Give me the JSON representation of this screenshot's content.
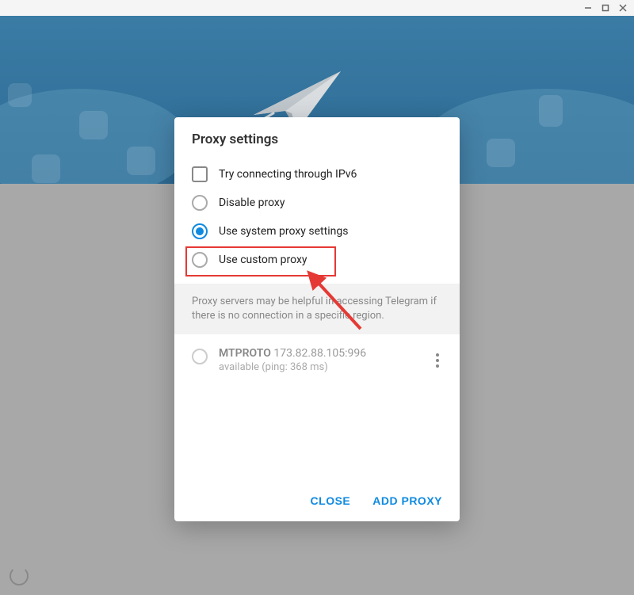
{
  "dialog": {
    "title": "Proxy settings",
    "options": {
      "ipv6": "Try connecting through IPv6",
      "disable": "Disable proxy",
      "system": "Use system proxy settings",
      "custom": "Use custom proxy"
    },
    "info_text": "Proxy servers may be helpful in accessing Telegram if there is no connection in a specific region.",
    "proxy": {
      "protocol": "MTPROTO",
      "address": "173.82.88.105:996",
      "status": "available (ping: 368 ms)"
    },
    "actions": {
      "close": "CLOSE",
      "add": "ADD PROXY"
    }
  }
}
